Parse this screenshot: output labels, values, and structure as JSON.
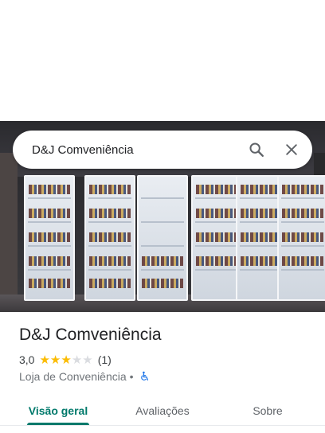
{
  "search": {
    "query": "D&J Comveniência",
    "search_icon": "search-icon",
    "close_icon": "close-icon"
  },
  "hero": {
    "subject": "storefront-photo"
  },
  "place": {
    "name": "D&J Comveniência",
    "rating": "3,0",
    "stars_filled": 3,
    "stars_total": 5,
    "review_count": "(1)",
    "category": "Loja de Conveniência",
    "separator": "•",
    "accessibility_icon": "wheelchair-icon"
  },
  "tabs": [
    {
      "label": "Visão geral",
      "active": true
    },
    {
      "label": "Avaliações",
      "active": false
    },
    {
      "label": "Sobre",
      "active": false
    }
  ],
  "colors": {
    "accent": "#00796b",
    "star": "#fbbc04",
    "accessibility": "#1a73e8"
  }
}
